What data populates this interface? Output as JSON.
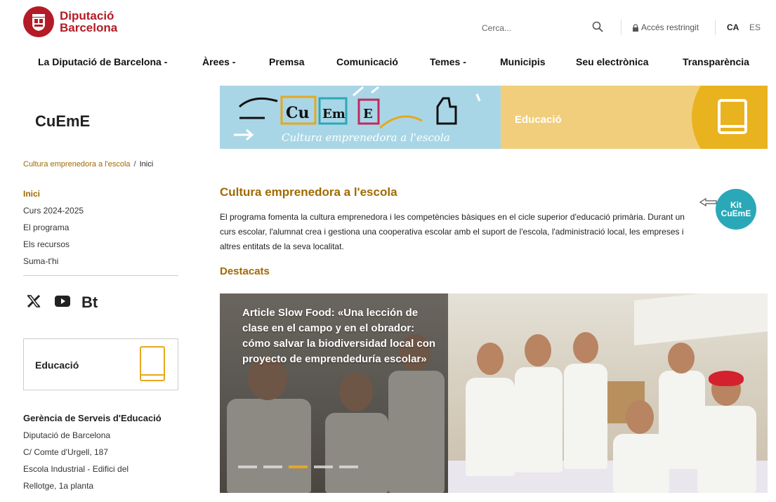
{
  "header": {
    "logo_line1": "Diputació",
    "logo_line2": "Barcelona",
    "search_placeholder": "Cerca...",
    "restricted_label": "Accés restringit",
    "lang_ca": "CA",
    "lang_es": "ES"
  },
  "nav": {
    "items": [
      {
        "label": "La Diputació de Barcelona -"
      },
      {
        "label": "Àrees -"
      },
      {
        "label": "Premsa"
      },
      {
        "label": "Comunicació"
      },
      {
        "label": "Temes -"
      },
      {
        "label": "Municipis"
      },
      {
        "label": "Seu electrònica"
      },
      {
        "label": "Transparència"
      }
    ]
  },
  "site": {
    "title": "CuEmE"
  },
  "banner": {
    "word1": "Cu",
    "word2": "Em",
    "word3": "E",
    "tagline": "Cultura emprenedora a l'escola",
    "section": "Educació"
  },
  "breadcrumb": {
    "link": "Cultura emprenedora a l'escola",
    "separator": "/",
    "current": "Inici"
  },
  "sidebar": {
    "items": [
      {
        "label": "Inici"
      },
      {
        "label": "Curs 2024-2025"
      },
      {
        "label": "El programa"
      },
      {
        "label": "Els recursos"
      },
      {
        "label": "Suma-t'hi"
      }
    ],
    "social": {
      "bt_label": "Bt"
    },
    "edu_box_label": "Educació",
    "contact": {
      "org": "Gerència de Serveis d'Educació",
      "line1": "Diputació de Barcelona",
      "line2": "C/ Comte d'Urgell, 187",
      "line3": " Escola Industrial - Edifici del",
      "line4": "Rellotge, 1a planta"
    }
  },
  "main": {
    "title": "Cultura emprenedora a l'escola",
    "description": "El programa fomenta la cultura emprenedora i les competències bàsiques en el cicle superior d'educació primària. Durant un curs escolar, l'alumnat crea i  gestiona una cooperativa escolar amb el  suport de l'escola, l'administració local,  les empreses i altres entitats de la seva localitat.",
    "kit_line1": "Kit",
    "kit_line2": "CuEmE",
    "highlights_title": "Destacats",
    "slide_caption": "Article Slow Food: «Una lección de clase en el campo y en el obrador: cómo salvar la biodiversidad local con proyecto de emprendeduría escolar»",
    "slide_count": 5,
    "active_slide": 3
  },
  "colors": {
    "brand_red": "#b31b26",
    "accent_gold": "#a06a00",
    "banner_blue": "#a9d6e6",
    "banner_yellow": "#e9b21f",
    "kit_teal": "#2ba8b8"
  }
}
